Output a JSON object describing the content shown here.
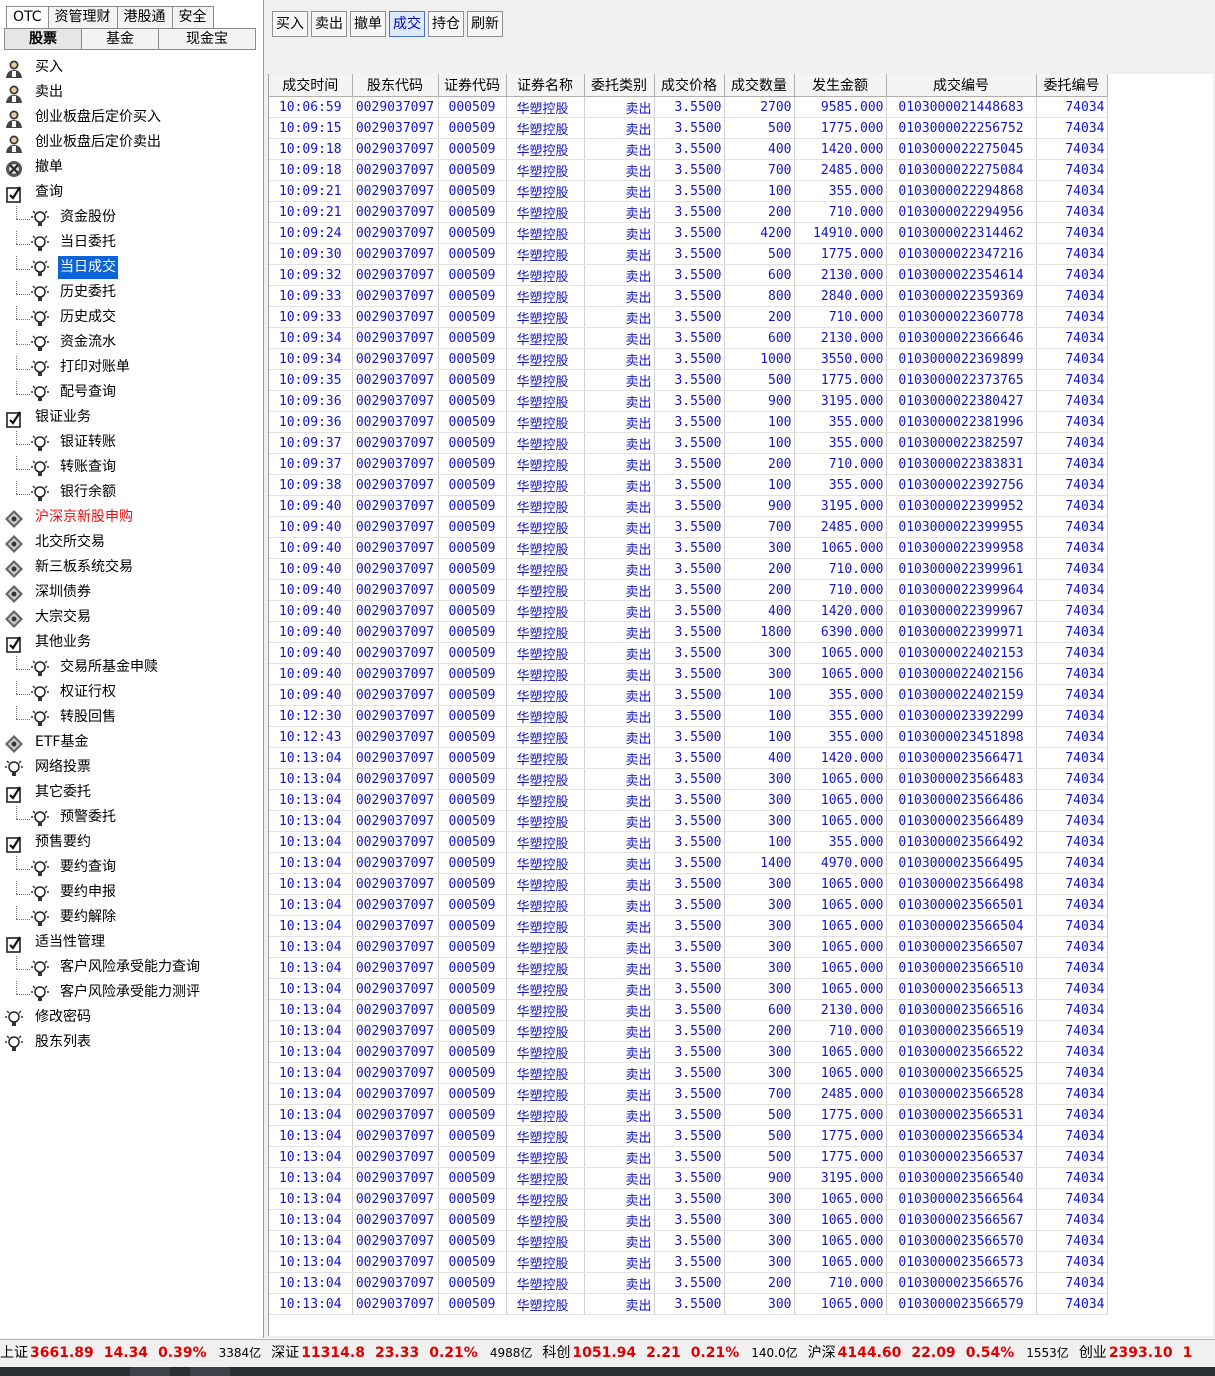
{
  "top_tabs": [
    "OTC",
    "资管理财",
    "港股通",
    "安全"
  ],
  "sub_tabs": [
    "股票",
    "基金",
    "现金宝"
  ],
  "tree": [
    {
      "label": "买入",
      "level": 0,
      "icon": "person-buy-icon"
    },
    {
      "label": "卖出",
      "level": 0,
      "icon": "person-sell-icon"
    },
    {
      "label": "创业板盘后定价买入",
      "level": 0,
      "icon": "person-buy-icon"
    },
    {
      "label": "创业板盘后定价卖出",
      "level": 0,
      "icon": "person-sell-icon"
    },
    {
      "label": "撤单",
      "level": 0,
      "icon": "cancel-order-icon"
    },
    {
      "label": "查询",
      "level": 0,
      "icon": "folder-check-icon"
    },
    {
      "label": "资金股份",
      "level": 1,
      "icon": "bulb-icon"
    },
    {
      "label": "当日委托",
      "level": 1,
      "icon": "bulb-icon"
    },
    {
      "label": "当日成交",
      "level": 1,
      "icon": "bulb-icon",
      "selected": true
    },
    {
      "label": "历史委托",
      "level": 1,
      "icon": "bulb-icon"
    },
    {
      "label": "历史成交",
      "level": 1,
      "icon": "bulb-icon"
    },
    {
      "label": "资金流水",
      "level": 1,
      "icon": "bulb-icon"
    },
    {
      "label": "打印对账单",
      "level": 1,
      "icon": "bulb-icon"
    },
    {
      "label": "配号查询",
      "level": 1,
      "icon": "bulb-icon"
    },
    {
      "label": "银证业务",
      "level": 0,
      "icon": "folder-check-icon"
    },
    {
      "label": "银证转账",
      "level": 1,
      "icon": "bulb-icon"
    },
    {
      "label": "转账查询",
      "level": 1,
      "icon": "bulb-icon"
    },
    {
      "label": "银行余额",
      "level": 1,
      "icon": "bulb-icon"
    },
    {
      "label": "沪深京新股申购",
      "level": 0,
      "icon": "diamond-icon",
      "red": true
    },
    {
      "label": "北交所交易",
      "level": 0,
      "icon": "diamond-icon"
    },
    {
      "label": "新三板系统交易",
      "level": 0,
      "icon": "diamond-icon"
    },
    {
      "label": "深圳债券",
      "level": 0,
      "icon": "diamond-icon"
    },
    {
      "label": "大宗交易",
      "level": 0,
      "icon": "diamond-icon"
    },
    {
      "label": "其他业务",
      "level": 0,
      "icon": "folder-check-icon"
    },
    {
      "label": "交易所基金申赎",
      "level": 1,
      "icon": "bulb-icon"
    },
    {
      "label": "权证行权",
      "level": 1,
      "icon": "bulb-icon"
    },
    {
      "label": "转股回售",
      "level": 1,
      "icon": "bulb-icon"
    },
    {
      "label": "ETF基金",
      "level": 0,
      "icon": "diamond-icon"
    },
    {
      "label": "网络投票",
      "level": 0,
      "icon": "bulb-icon"
    },
    {
      "label": "其它委托",
      "level": 0,
      "icon": "folder-check-icon"
    },
    {
      "label": "预警委托",
      "level": 1,
      "icon": "bulb-icon"
    },
    {
      "label": "预售要约",
      "level": 0,
      "icon": "folder-check-icon"
    },
    {
      "label": "要约查询",
      "level": 1,
      "icon": "bulb-icon"
    },
    {
      "label": "要约申报",
      "level": 1,
      "icon": "bulb-icon"
    },
    {
      "label": "要约解除",
      "level": 1,
      "icon": "bulb-icon"
    },
    {
      "label": "适当性管理",
      "level": 0,
      "icon": "folder-check-icon"
    },
    {
      "label": "客户风险承受能力查询",
      "level": 1,
      "icon": "bulb-icon"
    },
    {
      "label": "客户风险承受能力测评",
      "level": 1,
      "icon": "bulb-icon"
    },
    {
      "label": "修改密码",
      "level": 0,
      "icon": "bulb-icon"
    },
    {
      "label": "股东列表",
      "level": 0,
      "icon": "bulb-icon"
    }
  ],
  "toolbar": [
    {
      "label": "买入"
    },
    {
      "label": "卖出"
    },
    {
      "label": "撤单"
    },
    {
      "label": "成交",
      "active": true
    },
    {
      "label": "持仓"
    },
    {
      "label": "刷新"
    }
  ],
  "columns": [
    "成交时间",
    "股东代码",
    "证券代码",
    "证券名称",
    "委托类别",
    "成交价格",
    "成交数量",
    "发生金额",
    "成交编号",
    "委托编号"
  ],
  "rows": [
    [
      "10:06:59",
      "0029037097",
      "000509",
      "华塑控股",
      "卖出",
      "3.5500",
      "2700",
      "9585.000",
      "0103000021448683",
      "74034"
    ],
    [
      "10:09:15",
      "0029037097",
      "000509",
      "华塑控股",
      "卖出",
      "3.5500",
      "500",
      "1775.000",
      "0103000022256752",
      "74034"
    ],
    [
      "10:09:18",
      "0029037097",
      "000509",
      "华塑控股",
      "卖出",
      "3.5500",
      "400",
      "1420.000",
      "0103000022275045",
      "74034"
    ],
    [
      "10:09:18",
      "0029037097",
      "000509",
      "华塑控股",
      "卖出",
      "3.5500",
      "700",
      "2485.000",
      "0103000022275084",
      "74034"
    ],
    [
      "10:09:21",
      "0029037097",
      "000509",
      "华塑控股",
      "卖出",
      "3.5500",
      "100",
      "355.000",
      "0103000022294868",
      "74034"
    ],
    [
      "10:09:21",
      "0029037097",
      "000509",
      "华塑控股",
      "卖出",
      "3.5500",
      "200",
      "710.000",
      "0103000022294956",
      "74034"
    ],
    [
      "10:09:24",
      "0029037097",
      "000509",
      "华塑控股",
      "卖出",
      "3.5500",
      "4200",
      "14910.000",
      "0103000022314462",
      "74034"
    ],
    [
      "10:09:30",
      "0029037097",
      "000509",
      "华塑控股",
      "卖出",
      "3.5500",
      "500",
      "1775.000",
      "0103000022347216",
      "74034"
    ],
    [
      "10:09:32",
      "0029037097",
      "000509",
      "华塑控股",
      "卖出",
      "3.5500",
      "600",
      "2130.000",
      "0103000022354614",
      "74034"
    ],
    [
      "10:09:33",
      "0029037097",
      "000509",
      "华塑控股",
      "卖出",
      "3.5500",
      "800",
      "2840.000",
      "0103000022359369",
      "74034"
    ],
    [
      "10:09:33",
      "0029037097",
      "000509",
      "华塑控股",
      "卖出",
      "3.5500",
      "200",
      "710.000",
      "0103000022360778",
      "74034"
    ],
    [
      "10:09:34",
      "0029037097",
      "000509",
      "华塑控股",
      "卖出",
      "3.5500",
      "600",
      "2130.000",
      "0103000022366646",
      "74034"
    ],
    [
      "10:09:34",
      "0029037097",
      "000509",
      "华塑控股",
      "卖出",
      "3.5500",
      "1000",
      "3550.000",
      "0103000022369899",
      "74034"
    ],
    [
      "10:09:35",
      "0029037097",
      "000509",
      "华塑控股",
      "卖出",
      "3.5500",
      "500",
      "1775.000",
      "0103000022373765",
      "74034"
    ],
    [
      "10:09:36",
      "0029037097",
      "000509",
      "华塑控股",
      "卖出",
      "3.5500",
      "900",
      "3195.000",
      "0103000022380427",
      "74034"
    ],
    [
      "10:09:36",
      "0029037097",
      "000509",
      "华塑控股",
      "卖出",
      "3.5500",
      "100",
      "355.000",
      "0103000022381996",
      "74034"
    ],
    [
      "10:09:37",
      "0029037097",
      "000509",
      "华塑控股",
      "卖出",
      "3.5500",
      "100",
      "355.000",
      "0103000022382597",
      "74034"
    ],
    [
      "10:09:37",
      "0029037097",
      "000509",
      "华塑控股",
      "卖出",
      "3.5500",
      "200",
      "710.000",
      "0103000022383831",
      "74034"
    ],
    [
      "10:09:38",
      "0029037097",
      "000509",
      "华塑控股",
      "卖出",
      "3.5500",
      "100",
      "355.000",
      "0103000022392756",
      "74034"
    ],
    [
      "10:09:40",
      "0029037097",
      "000509",
      "华塑控股",
      "卖出",
      "3.5500",
      "900",
      "3195.000",
      "0103000022399952",
      "74034"
    ],
    [
      "10:09:40",
      "0029037097",
      "000509",
      "华塑控股",
      "卖出",
      "3.5500",
      "700",
      "2485.000",
      "0103000022399955",
      "74034"
    ],
    [
      "10:09:40",
      "0029037097",
      "000509",
      "华塑控股",
      "卖出",
      "3.5500",
      "300",
      "1065.000",
      "0103000022399958",
      "74034"
    ],
    [
      "10:09:40",
      "0029037097",
      "000509",
      "华塑控股",
      "卖出",
      "3.5500",
      "200",
      "710.000",
      "0103000022399961",
      "74034"
    ],
    [
      "10:09:40",
      "0029037097",
      "000509",
      "华塑控股",
      "卖出",
      "3.5500",
      "200",
      "710.000",
      "0103000022399964",
      "74034"
    ],
    [
      "10:09:40",
      "0029037097",
      "000509",
      "华塑控股",
      "卖出",
      "3.5500",
      "400",
      "1420.000",
      "0103000022399967",
      "74034"
    ],
    [
      "10:09:40",
      "0029037097",
      "000509",
      "华塑控股",
      "卖出",
      "3.5500",
      "1800",
      "6390.000",
      "0103000022399971",
      "74034"
    ],
    [
      "10:09:40",
      "0029037097",
      "000509",
      "华塑控股",
      "卖出",
      "3.5500",
      "300",
      "1065.000",
      "0103000022402153",
      "74034"
    ],
    [
      "10:09:40",
      "0029037097",
      "000509",
      "华塑控股",
      "卖出",
      "3.5500",
      "300",
      "1065.000",
      "0103000022402156",
      "74034"
    ],
    [
      "10:09:40",
      "0029037097",
      "000509",
      "华塑控股",
      "卖出",
      "3.5500",
      "100",
      "355.000",
      "0103000022402159",
      "74034"
    ],
    [
      "10:12:30",
      "0029037097",
      "000509",
      "华塑控股",
      "卖出",
      "3.5500",
      "100",
      "355.000",
      "0103000023392299",
      "74034"
    ],
    [
      "10:12:43",
      "0029037097",
      "000509",
      "华塑控股",
      "卖出",
      "3.5500",
      "100",
      "355.000",
      "0103000023451898",
      "74034"
    ],
    [
      "10:13:04",
      "0029037097",
      "000509",
      "华塑控股",
      "卖出",
      "3.5500",
      "400",
      "1420.000",
      "0103000023566471",
      "74034"
    ],
    [
      "10:13:04",
      "0029037097",
      "000509",
      "华塑控股",
      "卖出",
      "3.5500",
      "300",
      "1065.000",
      "0103000023566483",
      "74034"
    ],
    [
      "10:13:04",
      "0029037097",
      "000509",
      "华塑控股",
      "卖出",
      "3.5500",
      "300",
      "1065.000",
      "0103000023566486",
      "74034"
    ],
    [
      "10:13:04",
      "0029037097",
      "000509",
      "华塑控股",
      "卖出",
      "3.5500",
      "300",
      "1065.000",
      "0103000023566489",
      "74034"
    ],
    [
      "10:13:04",
      "0029037097",
      "000509",
      "华塑控股",
      "卖出",
      "3.5500",
      "100",
      "355.000",
      "0103000023566492",
      "74034"
    ],
    [
      "10:13:04",
      "0029037097",
      "000509",
      "华塑控股",
      "卖出",
      "3.5500",
      "1400",
      "4970.000",
      "0103000023566495",
      "74034"
    ],
    [
      "10:13:04",
      "0029037097",
      "000509",
      "华塑控股",
      "卖出",
      "3.5500",
      "300",
      "1065.000",
      "0103000023566498",
      "74034"
    ],
    [
      "10:13:04",
      "0029037097",
      "000509",
      "华塑控股",
      "卖出",
      "3.5500",
      "300",
      "1065.000",
      "0103000023566501",
      "74034"
    ],
    [
      "10:13:04",
      "0029037097",
      "000509",
      "华塑控股",
      "卖出",
      "3.5500",
      "300",
      "1065.000",
      "0103000023566504",
      "74034"
    ],
    [
      "10:13:04",
      "0029037097",
      "000509",
      "华塑控股",
      "卖出",
      "3.5500",
      "300",
      "1065.000",
      "0103000023566507",
      "74034"
    ],
    [
      "10:13:04",
      "0029037097",
      "000509",
      "华塑控股",
      "卖出",
      "3.5500",
      "300",
      "1065.000",
      "0103000023566510",
      "74034"
    ],
    [
      "10:13:04",
      "0029037097",
      "000509",
      "华塑控股",
      "卖出",
      "3.5500",
      "300",
      "1065.000",
      "0103000023566513",
      "74034"
    ],
    [
      "10:13:04",
      "0029037097",
      "000509",
      "华塑控股",
      "卖出",
      "3.5500",
      "600",
      "2130.000",
      "0103000023566516",
      "74034"
    ],
    [
      "10:13:04",
      "0029037097",
      "000509",
      "华塑控股",
      "卖出",
      "3.5500",
      "200",
      "710.000",
      "0103000023566519",
      "74034"
    ],
    [
      "10:13:04",
      "0029037097",
      "000509",
      "华塑控股",
      "卖出",
      "3.5500",
      "300",
      "1065.000",
      "0103000023566522",
      "74034"
    ],
    [
      "10:13:04",
      "0029037097",
      "000509",
      "华塑控股",
      "卖出",
      "3.5500",
      "300",
      "1065.000",
      "0103000023566525",
      "74034"
    ],
    [
      "10:13:04",
      "0029037097",
      "000509",
      "华塑控股",
      "卖出",
      "3.5500",
      "700",
      "2485.000",
      "0103000023566528",
      "74034"
    ],
    [
      "10:13:04",
      "0029037097",
      "000509",
      "华塑控股",
      "卖出",
      "3.5500",
      "500",
      "1775.000",
      "0103000023566531",
      "74034"
    ],
    [
      "10:13:04",
      "0029037097",
      "000509",
      "华塑控股",
      "卖出",
      "3.5500",
      "500",
      "1775.000",
      "0103000023566534",
      "74034"
    ],
    [
      "10:13:04",
      "0029037097",
      "000509",
      "华塑控股",
      "卖出",
      "3.5500",
      "500",
      "1775.000",
      "0103000023566537",
      "74034"
    ],
    [
      "10:13:04",
      "0029037097",
      "000509",
      "华塑控股",
      "卖出",
      "3.5500",
      "900",
      "3195.000",
      "0103000023566540",
      "74034"
    ],
    [
      "10:13:04",
      "0029037097",
      "000509",
      "华塑控股",
      "卖出",
      "3.5500",
      "300",
      "1065.000",
      "0103000023566564",
      "74034"
    ],
    [
      "10:13:04",
      "0029037097",
      "000509",
      "华塑控股",
      "卖出",
      "3.5500",
      "300",
      "1065.000",
      "0103000023566567",
      "74034"
    ],
    [
      "10:13:04",
      "0029037097",
      "000509",
      "华塑控股",
      "卖出",
      "3.5500",
      "300",
      "1065.000",
      "0103000023566570",
      "74034"
    ],
    [
      "10:13:04",
      "0029037097",
      "000509",
      "华塑控股",
      "卖出",
      "3.5500",
      "300",
      "1065.000",
      "0103000023566573",
      "74034"
    ],
    [
      "10:13:04",
      "0029037097",
      "000509",
      "华塑控股",
      "卖出",
      "3.5500",
      "200",
      "710.000",
      "0103000023566576",
      "74034"
    ],
    [
      "10:13:04",
      "0029037097",
      "000509",
      "华塑控股",
      "卖出",
      "3.5500",
      "300",
      "1065.000",
      "0103000023566579",
      "74034"
    ]
  ],
  "status_bar": [
    {
      "name": "上证",
      "value": "3661.89",
      "change": "14.34",
      "pct": "0.39%",
      "volume": "3384亿"
    },
    {
      "name": "深证",
      "value": "11314.8",
      "change": "23.33",
      "pct": "0.21%",
      "volume": "4988亿"
    },
    {
      "name": "科创",
      "value": "1051.94",
      "change": "2.21",
      "pct": "0.21%",
      "volume": "140.0亿"
    },
    {
      "name": "沪深",
      "value": "4144.60",
      "change": "22.09",
      "pct": "0.54%",
      "volume": "1553亿"
    },
    {
      "name": "创业",
      "value": "2393.10",
      "change": "1",
      "pct": "",
      "volume": ""
    }
  ],
  "colors": {
    "grid_text": "#1414c8",
    "selected_bg": "#0a64d8",
    "red_text": "#e81010",
    "up_red": "#e00000"
  }
}
